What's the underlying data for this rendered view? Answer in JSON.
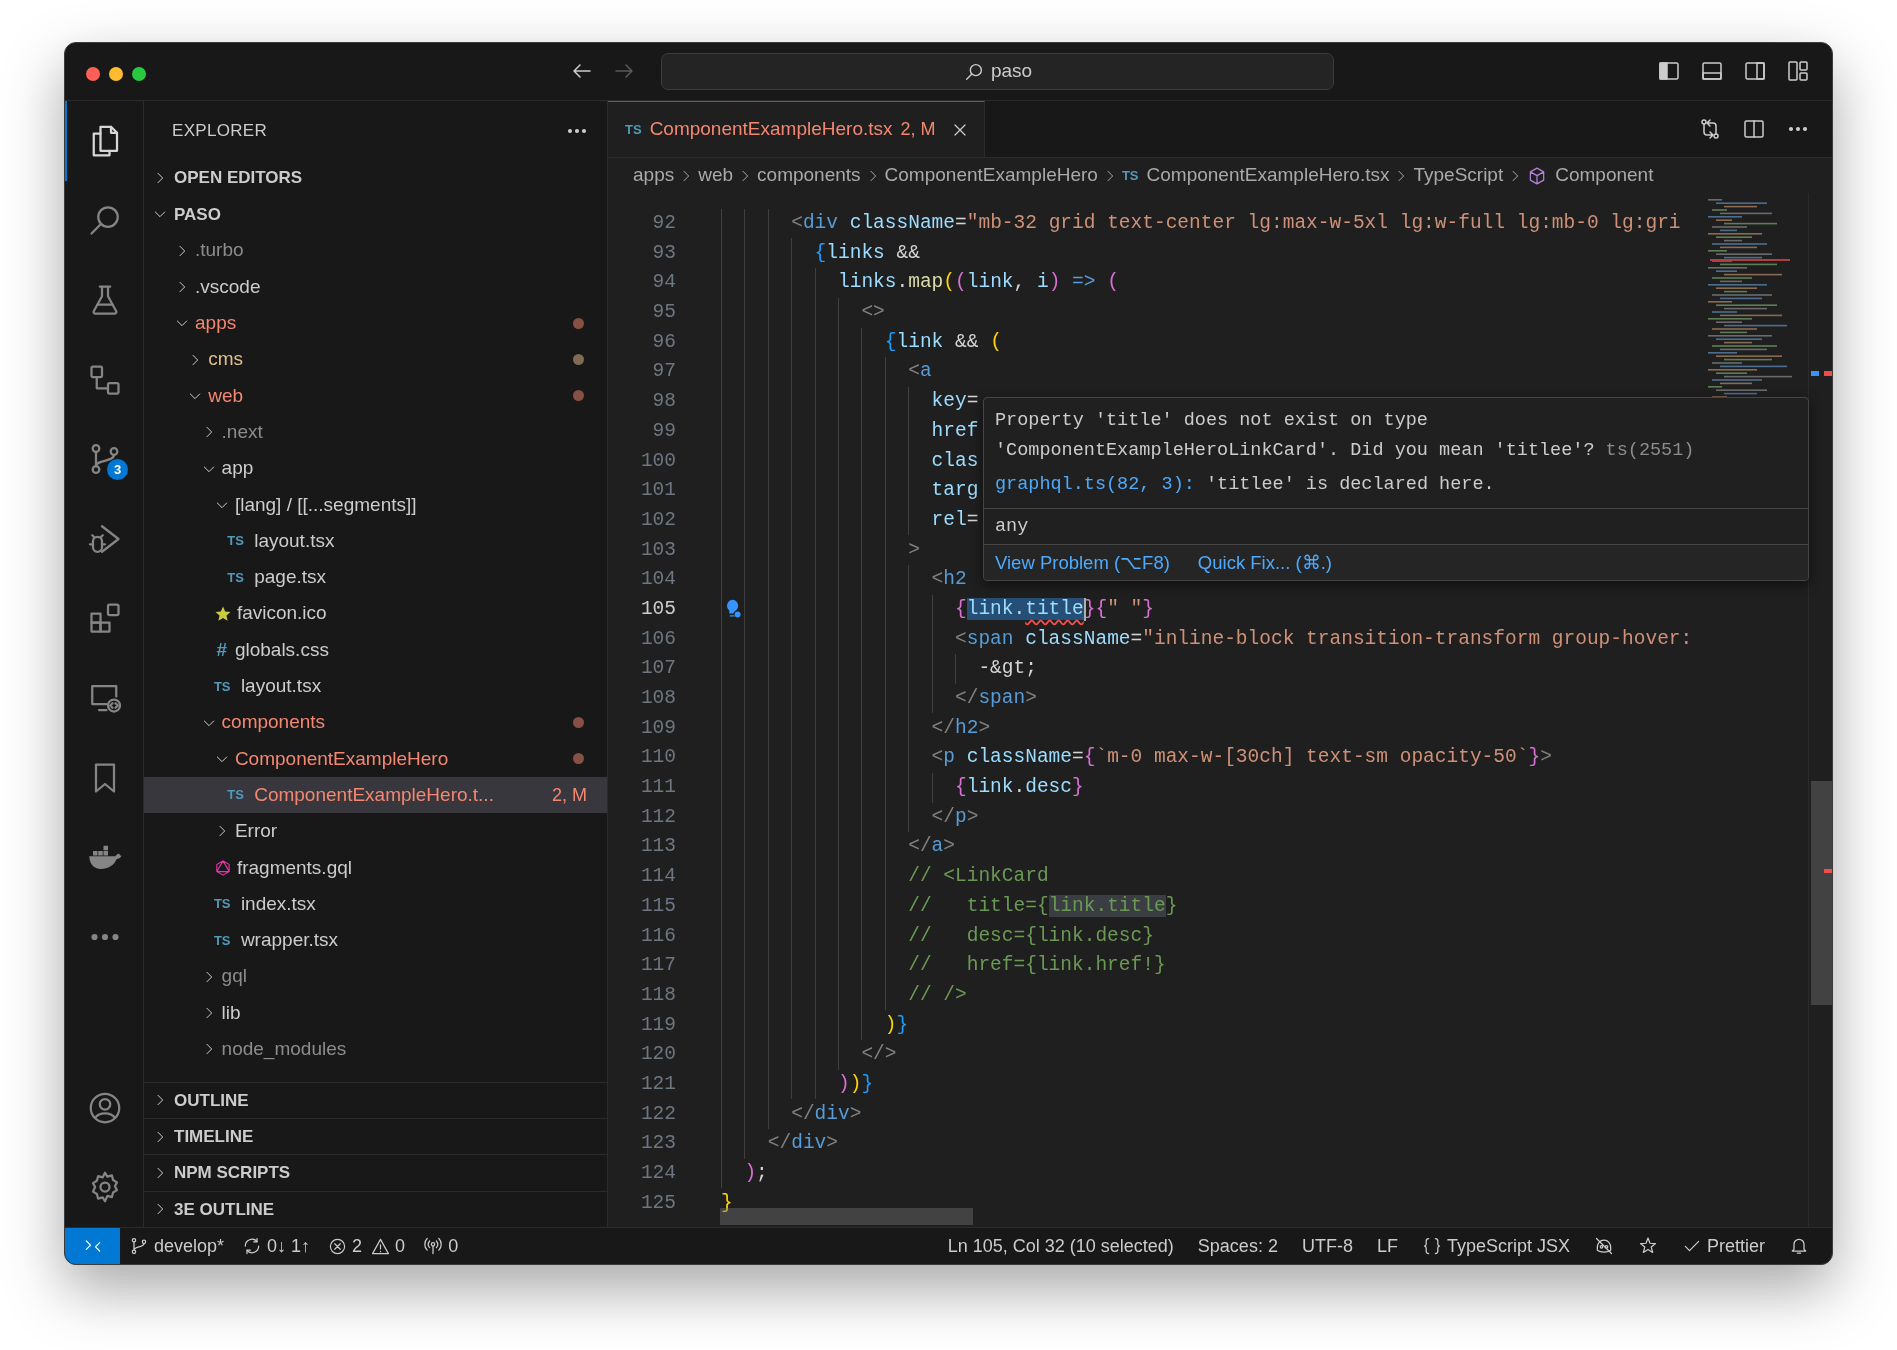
{
  "title_bar": {
    "nav": [
      {
        "kind": "back",
        "disabled": false
      },
      {
        "kind": "forward",
        "disabled": true
      }
    ],
    "search": {
      "value": "paso"
    },
    "layout_toggles": [
      {
        "kind": "primary-sidebar",
        "on": true
      },
      {
        "kind": "panel",
        "on": false
      },
      {
        "kind": "secondary-sidebar",
        "on": false
      },
      {
        "kind": "customize",
        "on": false
      }
    ]
  },
  "activity_bar": {
    "items": [
      {
        "kind": "explorer",
        "selected": true
      },
      {
        "kind": "search",
        "selected": false
      },
      {
        "kind": "testing",
        "selected": false
      },
      {
        "kind": "nodes",
        "selected": false
      },
      {
        "kind": "source-control",
        "selected": false,
        "badge": "3"
      },
      {
        "kind": "run-debug",
        "selected": false
      },
      {
        "kind": "extensions",
        "selected": false
      },
      {
        "kind": "remote",
        "selected": false
      },
      {
        "kind": "bookmarks",
        "selected": false
      },
      {
        "kind": "docker",
        "selected": false
      },
      {
        "kind": "more",
        "selected": false
      }
    ],
    "bottom": [
      {
        "kind": "accounts",
        "selected": false
      },
      {
        "kind": "settings",
        "selected": false
      }
    ]
  },
  "sidebar": {
    "title": "EXPLORER",
    "sections": [
      {
        "label": "OPEN EDITORS",
        "expanded": false
      },
      {
        "label": "PASO",
        "expanded": true,
        "tree": [
          {
            "label": ".turbo",
            "kind": "folder",
            "expanded": false,
            "color": "#8c8c8c",
            "dot": false,
            "selected": false
          },
          {
            "label": ".vscode",
            "kind": "folder",
            "expanded": false,
            "color": "#cccccc",
            "dot": false,
            "selected": false
          },
          {
            "label": "apps",
            "kind": "folder",
            "expanded": true,
            "color": "#f48771",
            "dot": true,
            "selected": false,
            "children": [
              {
                "label": "cms",
                "kind": "folder",
                "expanded": false,
                "color": "#e2c08d",
                "dot": true,
                "selected": false
              },
              {
                "label": "web",
                "kind": "folder",
                "expanded": true,
                "color": "#f48771",
                "dot": true,
                "selected": false,
                "children": [
                  {
                    "label": ".next",
                    "kind": "folder",
                    "expanded": false,
                    "color": "#8c8c8c",
                    "dot": false,
                    "selected": false
                  },
                  {
                    "label": "app",
                    "kind": "folder",
                    "expanded": true,
                    "color": "#cccccc",
                    "dot": false,
                    "selected": false,
                    "children": [
                      {
                        "label": "[lang] / [[...segments]]",
                        "kind": "folder",
                        "expanded": true,
                        "color": "#cccccc",
                        "dot": false,
                        "selected": false,
                        "children": [
                          {
                            "label": "layout.tsx",
                            "kind": "ts",
                            "icon_text": "TS",
                            "color": "#cccccc",
                            "selected": false
                          },
                          {
                            "label": "page.tsx",
                            "kind": "ts",
                            "icon_text": "TS",
                            "color": "#cccccc",
                            "selected": false
                          }
                        ]
                      },
                      {
                        "label": "favicon.ico",
                        "kind": "ico",
                        "color": "#cccccc",
                        "selected": false
                      },
                      {
                        "label": "globals.css",
                        "kind": "css",
                        "icon_text": "#",
                        "color": "#cccccc",
                        "selected": false
                      },
                      {
                        "label": "layout.tsx",
                        "kind": "ts",
                        "icon_text": "TS",
                        "color": "#cccccc",
                        "selected": false
                      }
                    ]
                  },
                  {
                    "label": "components",
                    "kind": "folder",
                    "expanded": true,
                    "color": "#f48771",
                    "dot": true,
                    "selected": false,
                    "children": [
                      {
                        "label": "ComponentExampleHero",
                        "kind": "folder",
                        "expanded": true,
                        "color": "#f48771",
                        "dot": true,
                        "selected": false,
                        "children": [
                          {
                            "label": "ComponentExampleHero.t...",
                            "kind": "ts",
                            "icon_text": "TS",
                            "color": "#f48771",
                            "selected": true,
                            "badge": "2, M"
                          }
                        ]
                      },
                      {
                        "label": "Error",
                        "kind": "folder",
                        "expanded": false,
                        "color": "#cccccc",
                        "dot": false,
                        "selected": false
                      },
                      {
                        "label": "fragments.gql",
                        "kind": "gql",
                        "color": "#cccccc",
                        "selected": false
                      },
                      {
                        "label": "index.tsx",
                        "kind": "ts",
                        "icon_text": "TS",
                        "color": "#cccccc",
                        "selected": false
                      },
                      {
                        "label": "wrapper.tsx",
                        "kind": "ts",
                        "icon_text": "TS",
                        "color": "#cccccc",
                        "selected": false
                      }
                    ]
                  },
                  {
                    "label": "gql",
                    "kind": "folder",
                    "expanded": false,
                    "color": "#8c8c8c",
                    "dot": false,
                    "selected": false
                  },
                  {
                    "label": "lib",
                    "kind": "folder",
                    "expanded": false,
                    "color": "#cccccc",
                    "dot": false,
                    "selected": false
                  },
                  {
                    "label": "node_modules",
                    "kind": "folder",
                    "expanded": false,
                    "color": "#8c8c8c",
                    "dot": false,
                    "selected": false
                  }
                ]
              }
            ]
          }
        ]
      },
      {
        "label": "OUTLINE",
        "expanded": false
      },
      {
        "label": "TIMELINE",
        "expanded": false
      },
      {
        "label": "NPM SCRIPTS",
        "expanded": false
      },
      {
        "label": "3E OUTLINE",
        "expanded": false
      }
    ]
  },
  "editor": {
    "tabs": [
      {
        "icon_text": "TS",
        "label": "ComponentExampleHero.tsx",
        "badge": "2, M",
        "color": "#f48771",
        "selected": true
      }
    ],
    "breadcrumbs": [
      {
        "kind": "folder",
        "label": "apps"
      },
      {
        "kind": "folder",
        "label": "web"
      },
      {
        "kind": "folder",
        "label": "components"
      },
      {
        "kind": "folder",
        "label": "ComponentExampleHero"
      },
      {
        "kind": "file",
        "label": "ComponentExampleHero.tsx",
        "icon_text": "TS"
      },
      {
        "kind": "language",
        "label": "TypeScript"
      },
      {
        "kind": "symbol",
        "label": "Component"
      }
    ],
    "lines": [
      {
        "number": "92",
        "current": false,
        "text": "      <div className=\"mb-32 grid text-center lg:max-w-5xl lg:w-full lg:mb-0 lg:gri"
      },
      {
        "number": "93",
        "current": false,
        "text": "        {links &&"
      },
      {
        "number": "94",
        "current": false,
        "text": "          links.map((link, i) => ("
      },
      {
        "number": "95",
        "current": false,
        "text": "            <>"
      },
      {
        "number": "96",
        "current": false,
        "text": "              {link && ("
      },
      {
        "number": "97",
        "current": false,
        "text": "                <a"
      },
      {
        "number": "98",
        "current": false,
        "text": "                  key="
      },
      {
        "number": "99",
        "current": false,
        "text": "                  href"
      },
      {
        "number": "100",
        "current": false,
        "text": "                  clas"
      },
      {
        "number": "101",
        "current": false,
        "text": "                  targ"
      },
      {
        "number": "102",
        "current": false,
        "text": "                  rel="
      },
      {
        "number": "103",
        "current": false,
        "text": "                >"
      },
      {
        "number": "104",
        "current": false,
        "text": "                  <h2"
      },
      {
        "number": "105",
        "current": true,
        "text": "                    {link.title}{\" \"}"
      },
      {
        "number": "106",
        "current": false,
        "text": "                    <span className=\"inline-block transition-transform group-hover:"
      },
      {
        "number": "107",
        "current": false,
        "text": "                      -&gt;"
      },
      {
        "number": "108",
        "current": false,
        "text": "                    </span>"
      },
      {
        "number": "109",
        "current": false,
        "text": "                  </h2>"
      },
      {
        "number": "110",
        "current": false,
        "text": "                  <p className={`m-0 max-w-[30ch] text-sm opacity-50`}>"
      },
      {
        "number": "111",
        "current": false,
        "text": "                    {link.desc}"
      },
      {
        "number": "112",
        "current": false,
        "text": "                  </p>"
      },
      {
        "number": "113",
        "current": false,
        "text": "                </a>"
      },
      {
        "number": "114",
        "current": false,
        "text": "                // <LinkCard"
      },
      {
        "number": "115",
        "current": false,
        "text": "                //   title={link.title}"
      },
      {
        "number": "116",
        "current": false,
        "text": "                //   desc={link.desc}"
      },
      {
        "number": "117",
        "current": false,
        "text": "                //   href={link.href!}"
      },
      {
        "number": "118",
        "current": false,
        "text": "                // />"
      },
      {
        "number": "119",
        "current": false,
        "text": "              )}"
      },
      {
        "number": "120",
        "current": false,
        "text": "            </>"
      },
      {
        "number": "121",
        "current": false,
        "text": "          ))}"
      },
      {
        "number": "122",
        "current": false,
        "text": "      </div>"
      },
      {
        "number": "123",
        "current": false,
        "text": "    </div>"
      },
      {
        "number": "124",
        "current": false,
        "text": "  );"
      },
      {
        "number": "125",
        "current": false,
        "text": "}"
      }
    ],
    "hover": {
      "message": "Property 'title' does not exist on type 'ComponentExampleHeroLinkCard'. Did you mean 'titlee'?",
      "code": "ts(2551)",
      "related_link": "graphql.ts(82, 3):",
      "related_text": " 'titlee' is declared here.",
      "type": "any",
      "actions": [
        "View Problem (⌥F8)",
        "Quick Fix... (⌘.)"
      ]
    }
  },
  "status_bar": {
    "left": [
      {
        "kind": "remote"
      },
      {
        "kind": "branch",
        "text": "develop*"
      },
      {
        "kind": "sync",
        "text": "0↓ 1↑"
      },
      {
        "kind": "problems",
        "errors": "2",
        "warnings": "0"
      },
      {
        "kind": "ports",
        "text": "0"
      }
    ],
    "right": [
      {
        "kind": "text",
        "text": "Ln 105, Col 32 (10 selected)"
      },
      {
        "kind": "text",
        "text": "Spaces: 2"
      },
      {
        "kind": "text",
        "text": "UTF-8"
      },
      {
        "kind": "text",
        "text": "LF"
      },
      {
        "kind": "language",
        "text": "TypeScript JSX"
      },
      {
        "kind": "copilot"
      },
      {
        "kind": "extension"
      },
      {
        "kind": "check",
        "text": "Prettier"
      },
      {
        "kind": "bell"
      }
    ]
  }
}
